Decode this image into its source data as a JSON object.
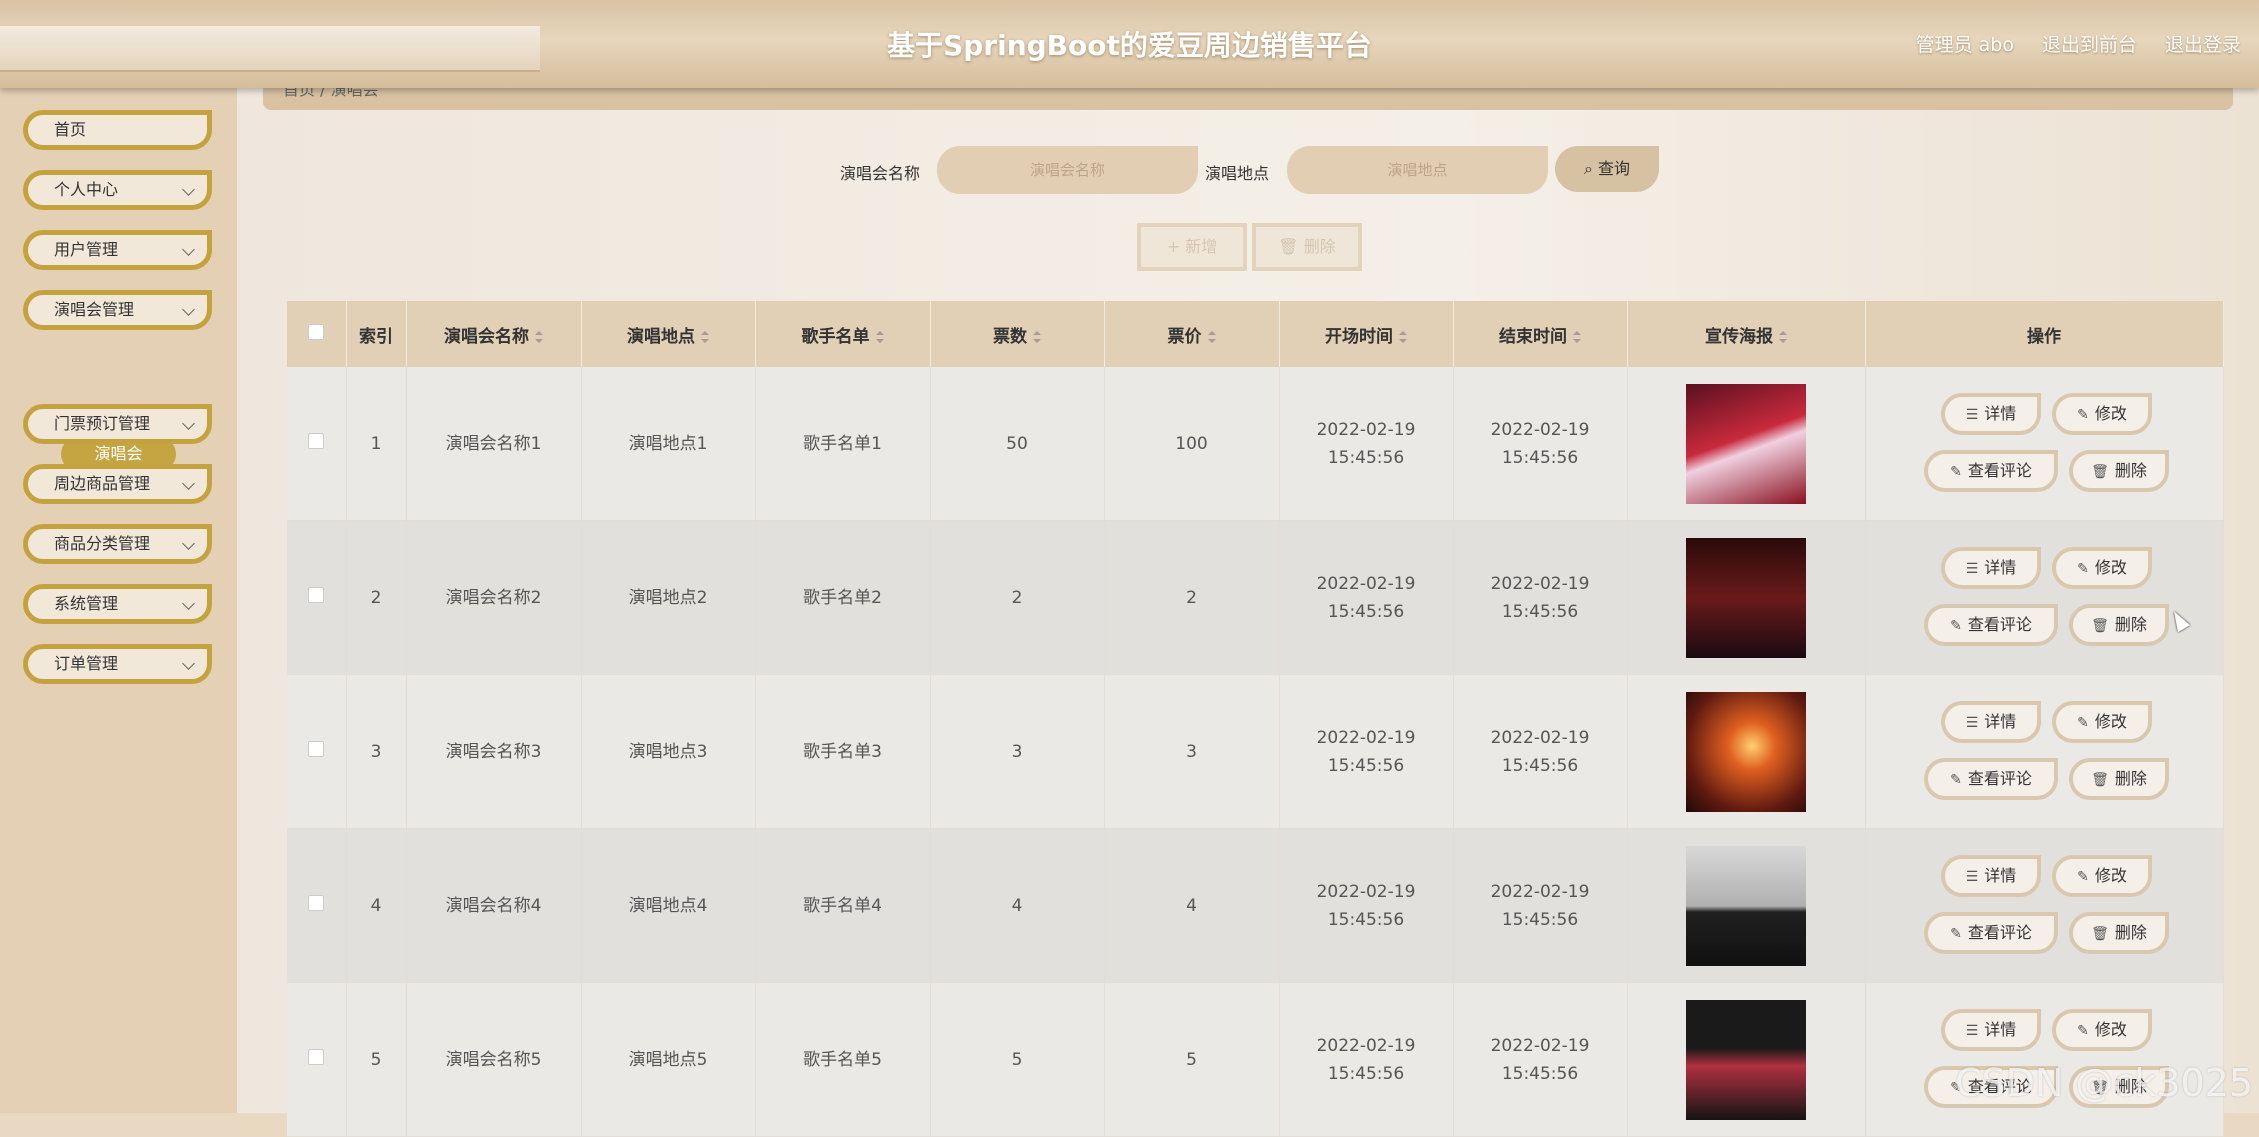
{
  "header": {
    "title": "基于SpringBoot的爱豆周边销售平台",
    "admin": "管理员 abo",
    "to_front": "退出到前台",
    "logout": "退出登录"
  },
  "sidebar": {
    "items": [
      {
        "label": "首页"
      },
      {
        "label": "个人中心"
      },
      {
        "label": "用户管理"
      },
      {
        "label": "演唱会管理"
      },
      {
        "label": "门票预订管理"
      },
      {
        "label": "周边商品管理"
      },
      {
        "label": "商品分类管理"
      },
      {
        "label": "系统管理"
      },
      {
        "label": "订单管理"
      }
    ],
    "active_sub": "演唱会"
  },
  "breadcrumb": "首页 / 演唱会",
  "search": {
    "name_label": "演唱会名称",
    "name_placeholder": "演唱会名称",
    "place_label": "演唱地点",
    "place_placeholder": "演唱地点",
    "query_label": "查询"
  },
  "actions": {
    "add": "新增",
    "delete": "删除"
  },
  "table": {
    "headers": [
      "索引",
      "演唱会名称",
      "演唱地点",
      "歌手名单",
      "票数",
      "票价",
      "开场时间",
      "结束时间",
      "宣传海报",
      "操作"
    ],
    "rows": [
      {
        "idx": "1",
        "name": "演唱会名称1",
        "place": "演唱地点1",
        "singers": "歌手名单1",
        "tickets": "50",
        "price": "100",
        "start": "2022-02-19 15:45:56",
        "end": "2022-02-19 15:45:56"
      },
      {
        "idx": "2",
        "name": "演唱会名称2",
        "place": "演唱地点2",
        "singers": "歌手名单2",
        "tickets": "2",
        "price": "2",
        "start": "2022-02-19 15:45:56",
        "end": "2022-02-19 15:45:56"
      },
      {
        "idx": "3",
        "name": "演唱会名称3",
        "place": "演唱地点3",
        "singers": "歌手名单3",
        "tickets": "3",
        "price": "3",
        "start": "2022-02-19 15:45:56",
        "end": "2022-02-19 15:45:56"
      },
      {
        "idx": "4",
        "name": "演唱会名称4",
        "place": "演唱地点4",
        "singers": "歌手名单4",
        "tickets": "4",
        "price": "4",
        "start": "2022-02-19 15:45:56",
        "end": "2022-02-19 15:45:56"
      },
      {
        "idx": "5",
        "name": "演唱会名称5",
        "place": "演唱地点5",
        "singers": "歌手名单5",
        "tickets": "5",
        "price": "5",
        "start": "2022-02-19 15:45:56",
        "end": "2022-02-19 15:45:56"
      }
    ],
    "ops": {
      "detail": "详情",
      "edit": "修改",
      "comment": "查看评论",
      "delete": "删除"
    }
  },
  "watermark": "CSDN @ck3025",
  "colors": {
    "accent": "#c4a33e",
    "header_bg": "#d9c3a3",
    "table_header": "#e1cfb6"
  }
}
